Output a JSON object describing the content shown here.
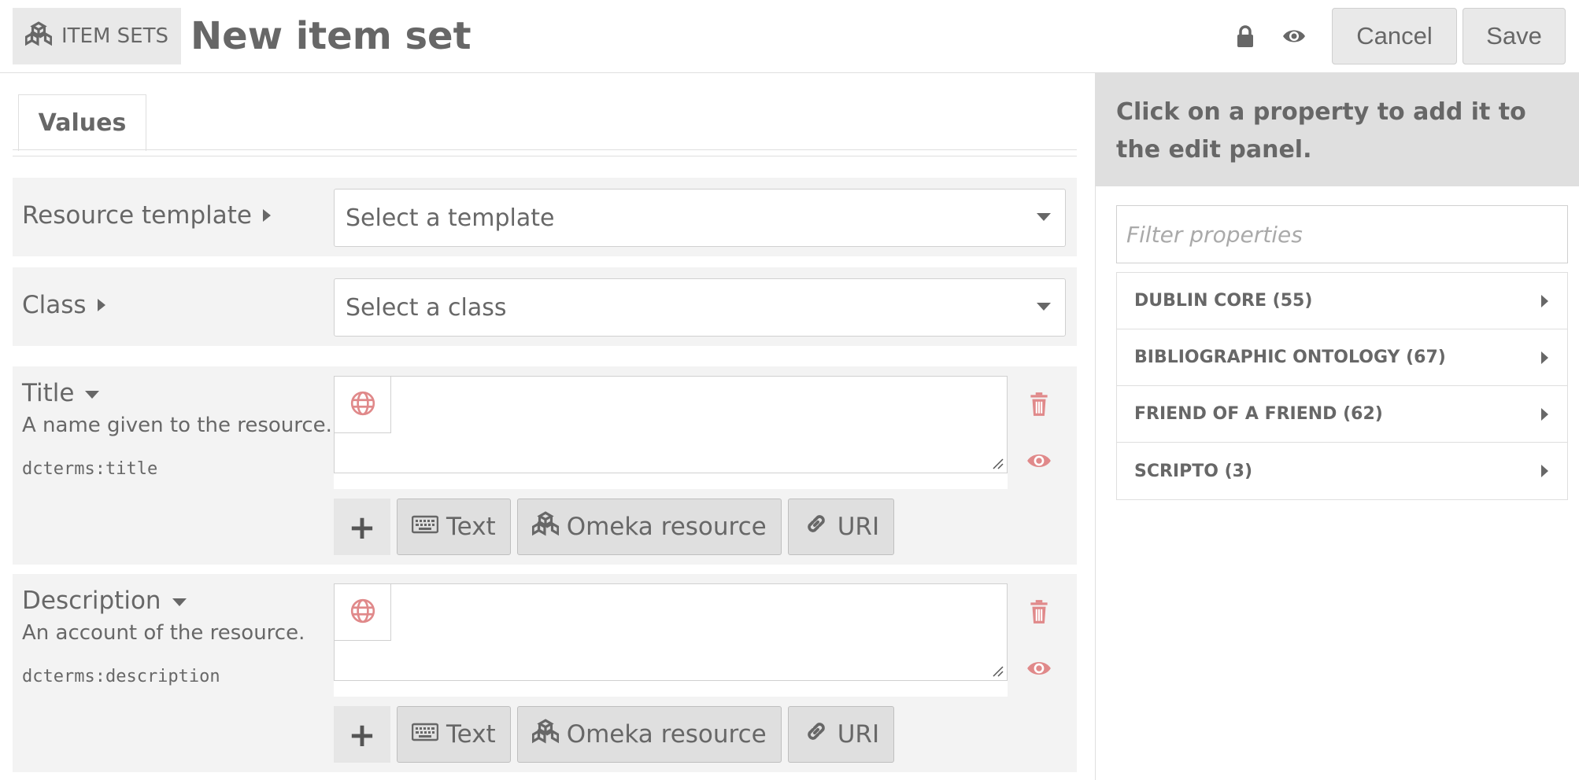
{
  "header": {
    "section_label": "ITEM SETS",
    "page_title": "New item set",
    "cancel_label": "Cancel",
    "save_label": "Save"
  },
  "tabs": [
    {
      "label": "Values"
    }
  ],
  "fields": {
    "resource_template": {
      "label": "Resource template",
      "select_value": "Select a template"
    },
    "class": {
      "label": "Class",
      "select_value": "Select a class"
    },
    "title": {
      "label": "Title",
      "description": "A name given to the resource.",
      "term": "dcterms:title"
    },
    "description": {
      "label": "Description",
      "description": "An account of the resource.",
      "term": "dcterms:description"
    }
  },
  "value_buttons": {
    "add": "+",
    "text": "Text",
    "omeka_resource": "Omeka resource",
    "uri": "URI"
  },
  "sidebar": {
    "intro": "Click on a property to add it to the edit panel.",
    "filter_placeholder": "Filter properties",
    "vocabularies": [
      {
        "label": "DUBLIN CORE (55)"
      },
      {
        "label": "BIBLIOGRAPHIC ONTOLOGY (67)"
      },
      {
        "label": "FRIEND OF A FRIEND (62)"
      },
      {
        "label": "SCRIPTO (3)"
      }
    ]
  },
  "colors": {
    "text": "#676767",
    "accent_red": "#e0898a",
    "panel_bg": "#f3f3f3",
    "sidebar_intro_bg": "#dfdfdf"
  },
  "icons": {
    "section": "cubes-icon",
    "lock": "lock-icon",
    "visibility": "eye-icon",
    "language": "globe-icon",
    "remove": "trash-icon",
    "private_toggle": "eye-icon",
    "text_type": "keyboard-icon",
    "resource_type": "cubes-icon",
    "uri_type": "link-icon"
  }
}
